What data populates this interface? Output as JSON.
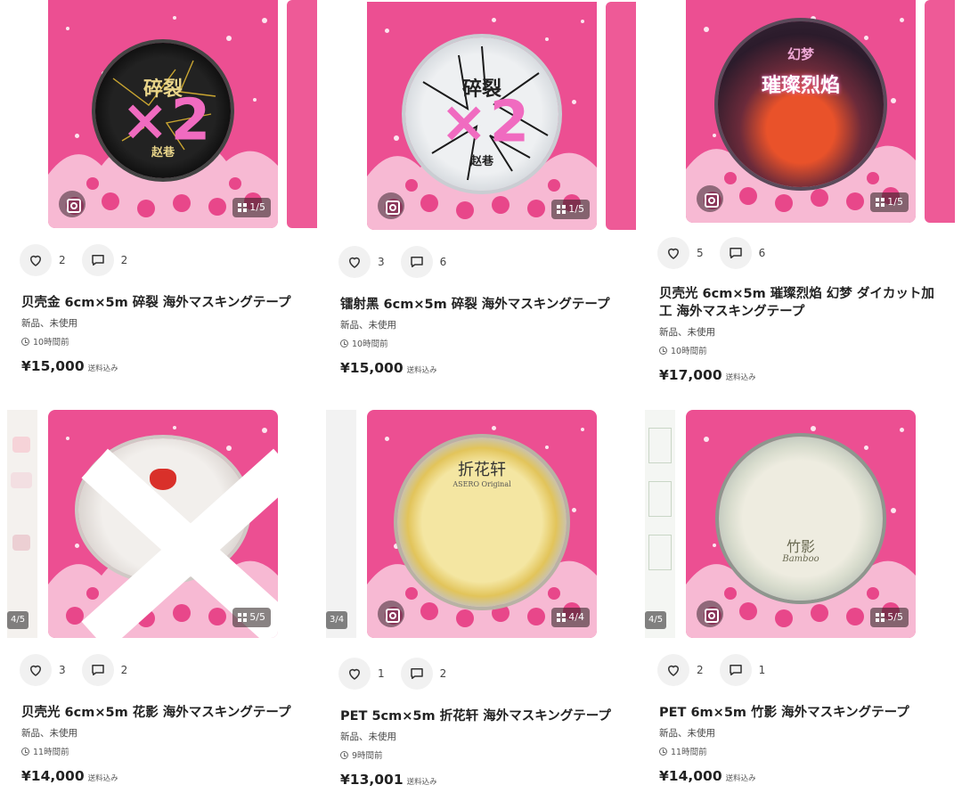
{
  "colors": {
    "pink_bg": "#ec4f92",
    "overlay_pink": "#f06bc0"
  },
  "listings": [
    {
      "title": "贝壳金 6cm×5m 碎裂 海外マスキングテープ",
      "condition": "新品、未使用",
      "time": "10時間前",
      "price": "¥15,000",
      "shipping": "送料込み",
      "likes": "2",
      "comments": "2",
      "image_counter": "1/5",
      "overlay": "×2",
      "tape_label": "碎裂",
      "tape_brand": "赵巷"
    },
    {
      "title": "镭射黑 6cm×5m 碎裂 海外マスキングテープ",
      "condition": "新品、未使用",
      "time": "10時間前",
      "price": "¥15,000",
      "shipping": "送料込み",
      "likes": "3",
      "comments": "6",
      "image_counter": "1/5",
      "overlay": "×2",
      "tape_label": "碎裂",
      "tape_brand": "赵巷"
    },
    {
      "title": "贝壳光 6cm×5m 璀璨烈焰 幻梦 ダイカット加工 海外マスキングテープ",
      "condition": "新品、未使用",
      "time": "10時間前",
      "price": "¥17,000",
      "shipping": "送料込み",
      "likes": "5",
      "comments": "6",
      "image_counter": "1/5",
      "tape_label": "璀璨烈焰",
      "tape_brand": "幻梦"
    },
    {
      "title": "贝壳光 6cm×5m 花影 海外マスキングテープ",
      "condition": "新品、未使用",
      "time": "11時間前",
      "price": "¥14,000",
      "shipping": "送料込み",
      "likes": "3",
      "comments": "2",
      "image_counter": "5/5",
      "peek_counter": "4/5"
    },
    {
      "title": "PET 5cm×5m 折花轩 海外マスキングテープ",
      "condition": "新品、未使用",
      "time": "9時間前",
      "price": "¥13,001",
      "shipping": "送料込み",
      "likes": "1",
      "comments": "2",
      "image_counter": "4/4",
      "peek_counter": "3/4",
      "tape_label": "折花轩",
      "tape_brand": "ASERO Original"
    },
    {
      "title": "PET 6m×5m 竹影 海外マスキングテープ",
      "condition": "新品、未使用",
      "time": "11時間前",
      "price": "¥14,000",
      "shipping": "送料込み",
      "likes": "2",
      "comments": "1",
      "image_counter": "5/5",
      "peek_counter": "4/5",
      "tape_label": "竹影",
      "tape_brand": "Bamboo"
    }
  ]
}
